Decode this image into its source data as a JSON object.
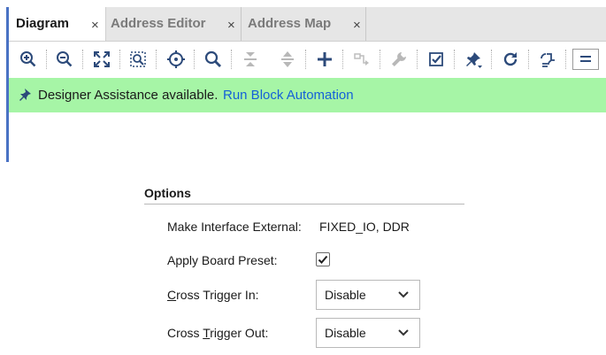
{
  "tabs": [
    {
      "label": "Diagram",
      "close": "×"
    },
    {
      "label": "Address Editor",
      "close": "×"
    },
    {
      "label": "Address Map",
      "close": "×"
    }
  ],
  "toolbar": {
    "icons": [
      "zoom-in-icon",
      "zoom-out-icon",
      "fit-full-icon",
      "zoom-area-icon",
      "center-target-icon",
      "search-icon",
      "collapse-icon",
      "expand-icon",
      "add-icon",
      "route-icon",
      "wrench-icon",
      "validate-icon",
      "pin-icon",
      "refresh-icon",
      "regenerate-icon",
      "menu-icon"
    ]
  },
  "banner": {
    "message": "Designer Assistance available.",
    "link": "Run Block Automation",
    "background": "#a6f5a6",
    "link_color": "#1460d8"
  },
  "options": {
    "title": "Options",
    "make_interface_external_label": "Make Interface External:",
    "make_interface_external_value": "FIXED_IO, DDR",
    "apply_board_preset_label": "Apply Board Preset:",
    "apply_board_preset_checked": true,
    "cross_trigger_in": {
      "first": "C",
      "rest": "ross Trigger In:",
      "value": "Disable"
    },
    "cross_trigger_out": {
      "before": "Cross ",
      "mnemonic": "T",
      "after": "rigger Out:",
      "value": "Disable"
    }
  }
}
